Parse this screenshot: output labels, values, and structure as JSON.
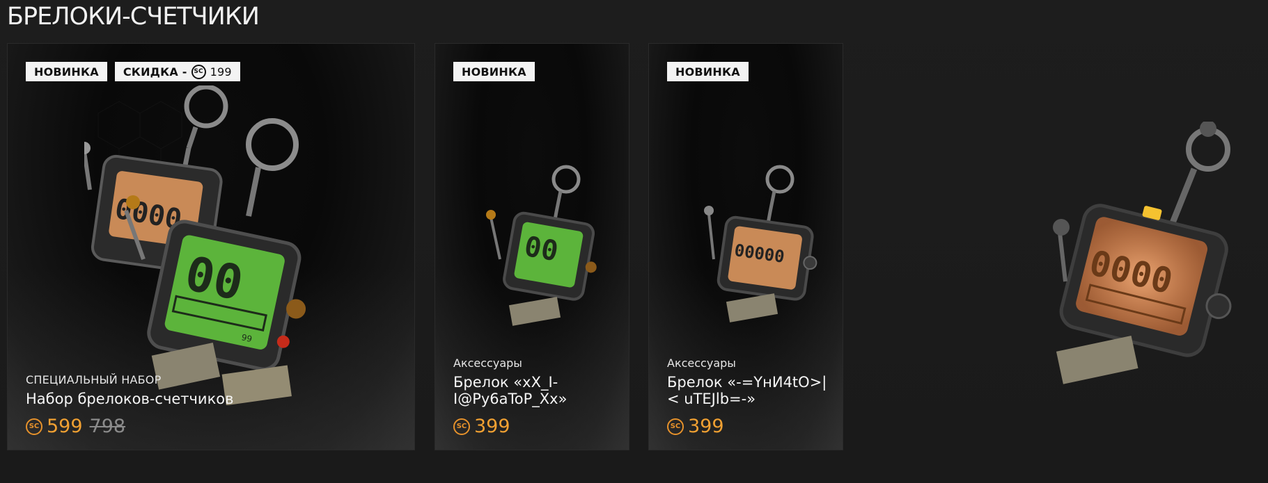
{
  "section": {
    "title": "БРЕЛОКИ-СЧЕТЧИКИ"
  },
  "currency": {
    "icon": "sc-coin-icon",
    "symbol": "SC",
    "color": "#e7922b"
  },
  "cards": [
    {
      "badges": [
        {
          "label": "НОВИНКА"
        },
        {
          "label": "СКИДКА -",
          "symbol": "SC",
          "amount": "199"
        }
      ],
      "category": "СПЕЦИАЛЬНЫЙ НАБОР",
      "name": "Набор брелоков-счетчиков",
      "price": "599",
      "old_price": "798"
    },
    {
      "badges": [
        {
          "label": "НОВИНКА"
        }
      ],
      "category": "Аксессуары",
      "name": "Брелок «xX_I-I@Py6aToP_Xx»",
      "price": "399",
      "art_readout": "00"
    },
    {
      "badges": [
        {
          "label": "НОВИНКА"
        }
      ],
      "category": "Аксессуары",
      "name": "Брелок «-=YнИ4tO>|< uTEJlb=-»",
      "price": "399",
      "art_readout": "00000"
    }
  ],
  "art": {
    "set_front_readout": "00",
    "set_back_readout": "0000",
    "hero_readout": "0000",
    "small_digits": "99"
  }
}
